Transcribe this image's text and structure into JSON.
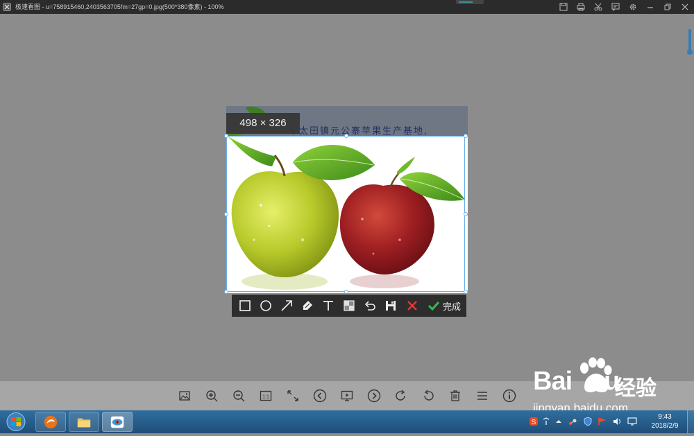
{
  "titlebar": {
    "title": "极速看图 - u=758915460,2403563705fm=27gp=0.jpg(500*380像素) - 100%"
  },
  "image": {
    "caption": "市太田镇元公寨苹果生产基地,",
    "selection_size": "498 × 326"
  },
  "edit_toolbar": {
    "tools": [
      "rectangle-icon",
      "circle-icon",
      "arrow-icon",
      "brush-icon",
      "text-icon",
      "mosaic-icon",
      "undo-icon",
      "save-icon",
      "cancel-icon",
      "confirm-icon"
    ],
    "done_label": "完成"
  },
  "viewer_toolbar": {
    "tools": [
      "image-icon",
      "zoom-in-icon",
      "zoom-out-icon",
      "actual-size-icon",
      "fit-window-icon",
      "prev-icon",
      "slideshow-icon",
      "next-icon",
      "rotate-right-icon",
      "rotate-left-icon",
      "delete-icon",
      "menu-icon",
      "info-icon"
    ],
    "actual_size_label": "1:1"
  },
  "watermark": {
    "brand": "Bai",
    "brand_tail": "u",
    "cn": "经验",
    "url": "jingyan.baidu.com"
  },
  "taskbar": {
    "time": "9:43",
    "date": "2018/2/9"
  },
  "colors": {
    "accent": "#6ab0e8",
    "cancel": "#e53935",
    "confirm": "#2fbf4a"
  }
}
